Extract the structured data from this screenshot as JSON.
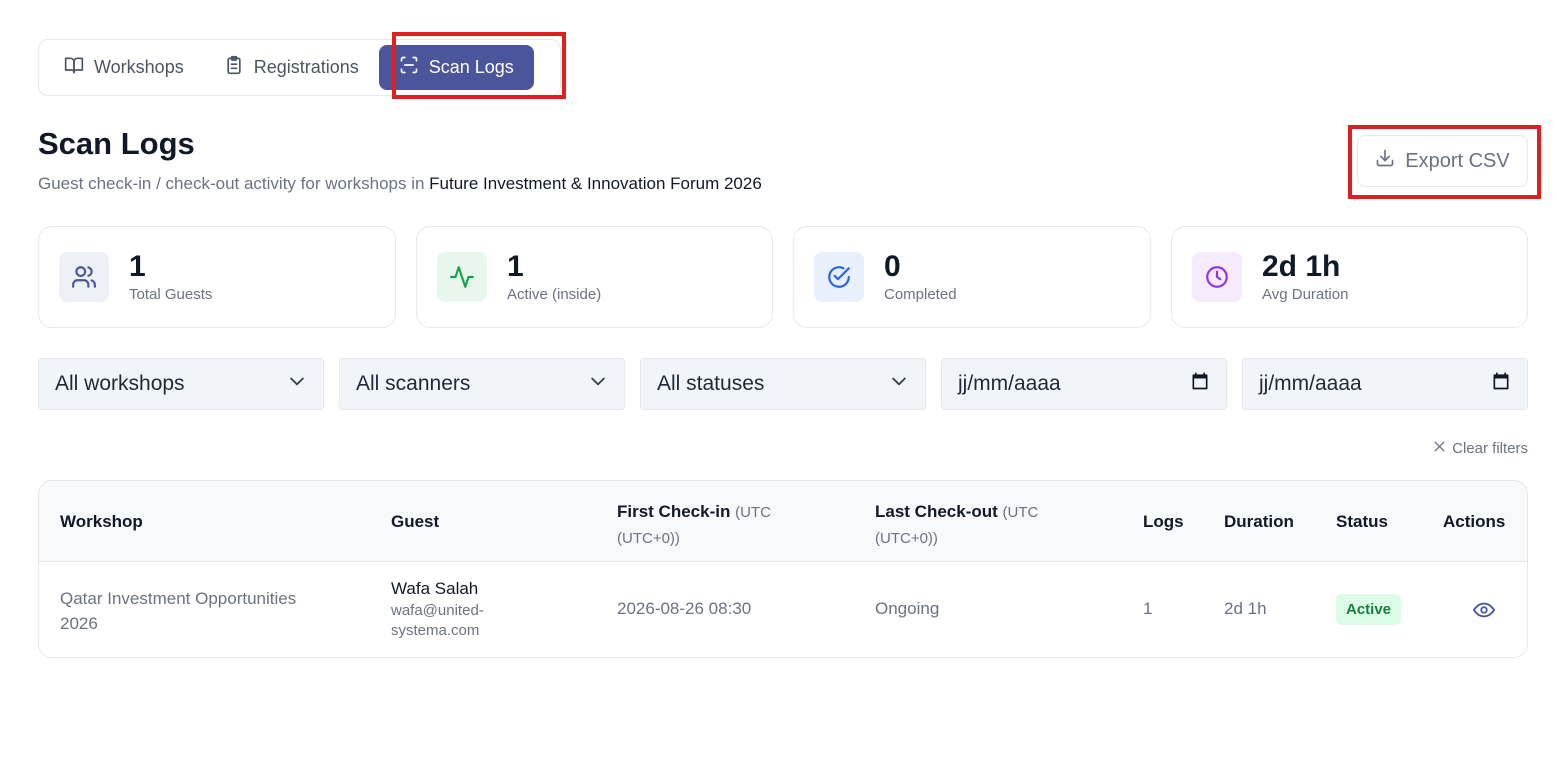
{
  "tabs": [
    {
      "label": "Workshops",
      "icon": "book-open-icon"
    },
    {
      "label": "Registrations",
      "icon": "clipboard-list-icon"
    },
    {
      "label": "Scan Logs",
      "icon": "scan-icon",
      "active": true
    }
  ],
  "header": {
    "title": "Scan Logs",
    "subtitle_prefix": "Guest check-in / check-out activity for workshops in ",
    "event_name": "Future Investment & Innovation Forum 2026",
    "export_label": "Export CSV"
  },
  "stats": [
    {
      "value": "1",
      "label": "Total Guests",
      "icon": "users-icon",
      "color": "#4b559c",
      "bg": "#eef0f7"
    },
    {
      "value": "1",
      "label": "Active (inside)",
      "icon": "activity-icon",
      "color": "#16a34a",
      "bg": "#e8f7ee"
    },
    {
      "value": "0",
      "label": "Completed",
      "icon": "check-circle-icon",
      "color": "#2563eb",
      "bg": "#e8f0fd"
    },
    {
      "value": "2d 1h",
      "label": "Avg Duration",
      "icon": "clock-icon",
      "color": "#9333ea",
      "bg": "#f5ebfd"
    }
  ],
  "filters": {
    "workshop": "All workshops",
    "scanner": "All scanners",
    "status": "All statuses",
    "date_from": "jj/mm/aaaa",
    "date_to": "jj/mm/aaaa",
    "clear_label": "Clear filters"
  },
  "table": {
    "columns": {
      "workshop": "Workshop",
      "guest": "Guest",
      "first_checkin": "First Check-in",
      "first_checkin_tz_a": "(UTC",
      "first_checkin_tz_b": "(UTC+0))",
      "last_checkout": "Last Check-out",
      "last_checkout_tz_a": "(UTC",
      "last_checkout_tz_b": "(UTC+0))",
      "logs": "Logs",
      "duration": "Duration",
      "status": "Status",
      "actions": "Actions"
    },
    "rows": [
      {
        "workshop_line1": "Qatar Investment Opportunities",
        "workshop_line2": "2026",
        "guest_name": "Wafa Salah",
        "guest_email_line1": "wafa@united-",
        "guest_email_line2": "systema.com",
        "first_checkin": "2026-08-26 08:30",
        "last_checkout": "Ongoing",
        "logs": "1",
        "duration": "2d 1h",
        "status": "Active"
      }
    ]
  },
  "colors": {
    "accent": "#4b559c",
    "highlight_box": "#e02020",
    "active_badge_bg": "#dcfce7",
    "active_badge_text": "#15803d"
  }
}
